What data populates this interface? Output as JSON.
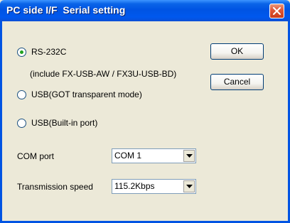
{
  "window": {
    "title": "PC side I/F  Serial setting",
    "close_icon": "close-icon"
  },
  "interface": {
    "options": [
      {
        "label": "RS-232C",
        "selected": true
      },
      {
        "label": "USB(GOT transparent mode)",
        "selected": false
      },
      {
        "label": "USB(Built-in port)",
        "selected": false
      }
    ],
    "rs232c_note": "(include FX-USB-AW / FX3U-USB-BD)"
  },
  "com_port": {
    "label": "COM port",
    "value": "COM 1"
  },
  "transmission_speed": {
    "label": "Transmission speed",
    "value": "115.2Kbps"
  },
  "buttons": {
    "ok_label": "OK",
    "cancel_label": "Cancel"
  },
  "colors": {
    "titlebar": "#0054e3",
    "dialog_background": "#ece9d8",
    "radio_selected": "#21a121"
  }
}
